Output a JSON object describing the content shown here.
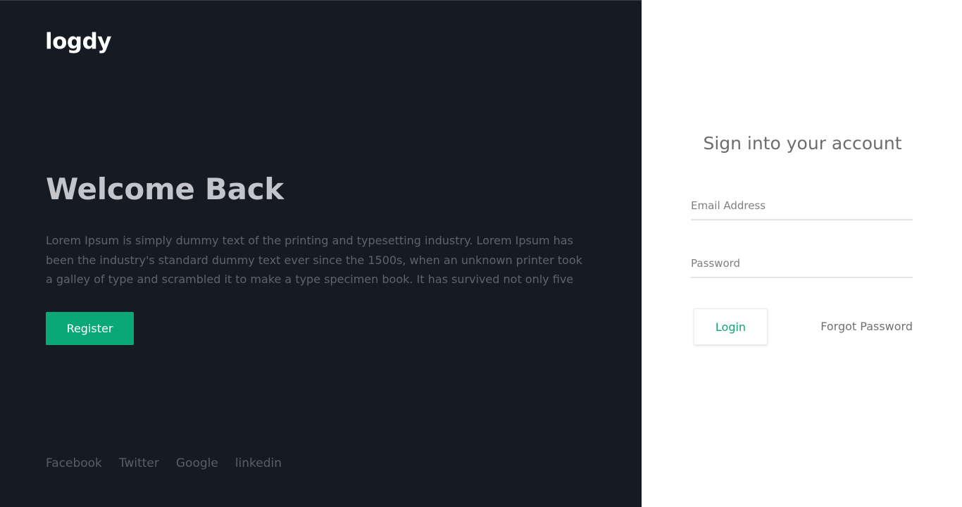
{
  "brand": {
    "logo_text": "logdy"
  },
  "welcome": {
    "title": "Welcome Back",
    "description": "Lorem Ipsum is simply dummy text of the printing and typesetting industry. Lorem Ipsum has been the industry's standard dummy text ever since the 1500s, when an unknown printer took a galley of type and scrambled it to make a type specimen book. It has survived not only five",
    "register_label": "Register"
  },
  "social": {
    "links": [
      "Facebook",
      "Twitter",
      "Google",
      "linkedin"
    ]
  },
  "signin": {
    "title": "Sign into your account",
    "email_placeholder": "Email Address",
    "password_placeholder": "Password",
    "login_label": "Login",
    "forgot_label": "Forgot Password"
  },
  "colors": {
    "left_background": "#161a23",
    "accent": "#0aa877",
    "right_background": "#ffffff"
  }
}
